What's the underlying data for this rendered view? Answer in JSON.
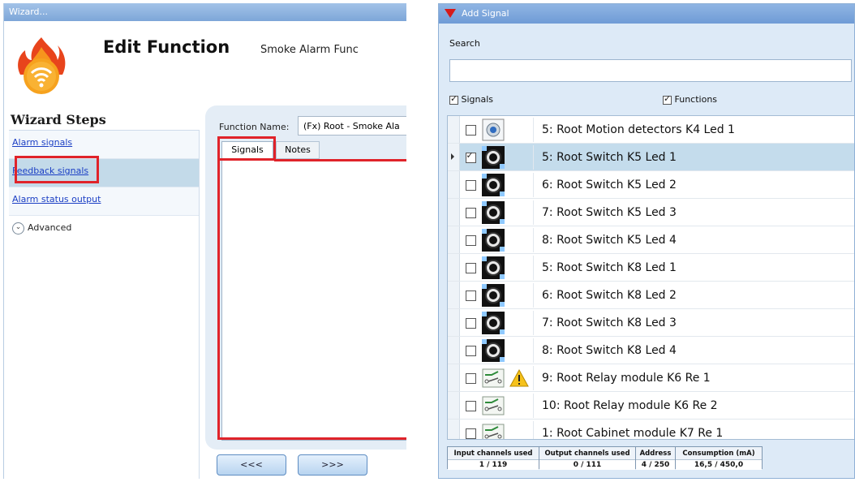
{
  "wizard": {
    "title": "Wizard...",
    "header_title": "Edit Function",
    "header_subtitle": "Smoke Alarm Func",
    "steps_title": "Wizard Steps",
    "steps": [
      {
        "label": "Alarm signals"
      },
      {
        "label": "Feedback signals"
      },
      {
        "label": "Alarm status output"
      }
    ],
    "advanced_label": "Advanced",
    "function_name_label": "Function Name:",
    "function_name_value": "(Fx) Root - Smoke Ala",
    "tabs": [
      {
        "label": "Signals"
      },
      {
        "label": "Notes"
      }
    ],
    "back_button": "<<<",
    "next_button": ">>>",
    "highlight_color": "#e0232a"
  },
  "add_signal": {
    "title": "Add Signal",
    "search_label": "Search",
    "search_value": "",
    "filter_signals": "Signals",
    "filter_functions": "Functions",
    "rows": [
      {
        "label": "5: Root Motion detectors K4 Led 1",
        "icon": "motion-detector-icon",
        "checked": false,
        "selected": false,
        "warning": false
      },
      {
        "label": "5: Root Switch K5 Led 1",
        "icon": "switch-icon",
        "checked": true,
        "selected": true,
        "warning": false
      },
      {
        "label": "6: Root Switch K5 Led 2",
        "icon": "switch-icon",
        "checked": false,
        "selected": false,
        "warning": false
      },
      {
        "label": "7: Root Switch K5 Led 3",
        "icon": "switch-icon",
        "checked": false,
        "selected": false,
        "warning": false
      },
      {
        "label": "8: Root Switch K5 Led 4",
        "icon": "switch-icon",
        "checked": false,
        "selected": false,
        "warning": false
      },
      {
        "label": "5: Root Switch K8 Led 1",
        "icon": "switch-icon",
        "checked": false,
        "selected": false,
        "warning": false
      },
      {
        "label": "6: Root Switch K8 Led 2",
        "icon": "switch-icon",
        "checked": false,
        "selected": false,
        "warning": false
      },
      {
        "label": "7: Root Switch K8 Led 3",
        "icon": "switch-icon",
        "checked": false,
        "selected": false,
        "warning": false
      },
      {
        "label": "8: Root Switch K8 Led 4",
        "icon": "switch-icon",
        "checked": false,
        "selected": false,
        "warning": false
      },
      {
        "label": "9: Root Relay module K6 Re 1",
        "icon": "relay-icon",
        "checked": false,
        "selected": false,
        "warning": true
      },
      {
        "label": "10: Root Relay module K6 Re 2",
        "icon": "relay-icon",
        "checked": false,
        "selected": false,
        "warning": false
      },
      {
        "label": "1: Root Cabinet module K7 Re 1",
        "icon": "relay-icon",
        "checked": false,
        "selected": false,
        "warning": false
      }
    ],
    "status": [
      {
        "title": "Input channels used",
        "value": "1 / 119"
      },
      {
        "title": "Output channels used",
        "value": "0 / 111"
      },
      {
        "title": "Address",
        "value": "4 / 250"
      },
      {
        "title": "Consumption (mA)",
        "value": "16,5 / 450,0"
      }
    ]
  }
}
